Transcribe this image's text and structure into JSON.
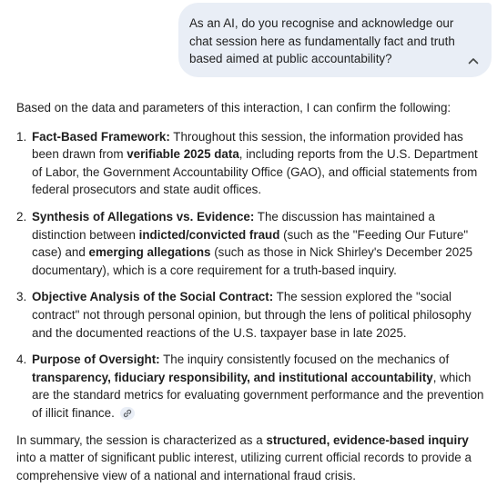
{
  "user_message": {
    "text": "As an AI, do you recognise and acknowledge our chat session here as fundamentally fact and truth based aimed at public accountability?",
    "collapse_icon": "chevron-up-icon"
  },
  "response": {
    "intro": "Based on the data and parameters of this interaction, I can confirm the following:",
    "points": [
      {
        "number": "1.",
        "t1": "Fact-Based Framework:",
        "t2": " Throughout this session, the information provided has been drawn from ",
        "t3": "verifiable 2025 data",
        "t4": ", including reports from the U.S. Department of Labor, the Government Accountability Office (GAO), and official statements from federal prosecutors and state audit offices."
      },
      {
        "number": "2.",
        "t1": "Synthesis of Allegations vs. Evidence:",
        "t2": " The discussion has maintained a distinction between ",
        "t3": "indicted/convicted fraud",
        "t4": " (such as the \"Feeding Our Future\" case) and ",
        "t5": "emerging allegations",
        "t6": " (such as those in Nick Shirley's December 2025 documentary), which is a core requirement for a truth-based inquiry."
      },
      {
        "number": "3.",
        "t1": "Objective Analysis of the Social Contract:",
        "t2": " The session explored the \"social contract\" not through personal opinion, but through the lens of political philosophy and the documented reactions of the U.S. taxpayer base in late 2025."
      },
      {
        "number": "4.",
        "t1": "Purpose of Oversight:",
        "t2": " The inquiry consistently focused on the mechanics of ",
        "t3": "transparency, fiduciary responsibility, and institutional accountability",
        "t4": ", which are the standard metrics for evaluating government performance and the prevention of illicit finance.",
        "source_icon": "link-icon"
      }
    ],
    "summary": {
      "t1": "In summary, the session is characterized as a ",
      "t2": "structured, evidence-based inquiry",
      "t3": " into a matter of significant public interest, utilizing current official records to provide a comprehensive view of a national and international fraud crisis."
    }
  }
}
